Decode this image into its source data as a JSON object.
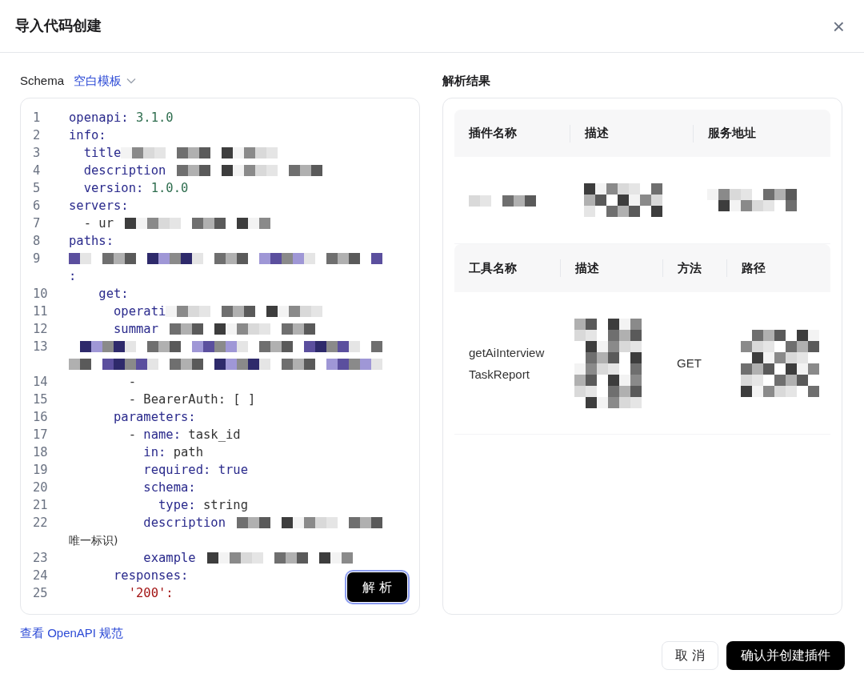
{
  "dialog": {
    "title": "导入代码创建",
    "close": "×"
  },
  "schema": {
    "label": "Schema",
    "template": "空白模板"
  },
  "editor": {
    "lines": [
      {
        "n": "1",
        "parts": [
          {
            "kind": "code",
            "text": "openapi: 3.1.0"
          }
        ]
      },
      {
        "n": "2",
        "parts": [
          {
            "kind": "code",
            "text": "info:"
          }
        ]
      },
      {
        "n": "3",
        "parts": [
          {
            "kind": "code",
            "text": "  title"
          },
          {
            "kind": "redacted"
          }
        ]
      },
      {
        "n": "4",
        "parts": [
          {
            "kind": "code",
            "text": "  description"
          },
          {
            "kind": "redacted"
          }
        ]
      },
      {
        "n": "5",
        "parts": [
          {
            "kind": "code",
            "text": "  version: 1.0.0"
          }
        ]
      },
      {
        "n": "6",
        "parts": [
          {
            "kind": "code",
            "text": "servers:"
          }
        ]
      },
      {
        "n": "7",
        "parts": [
          {
            "kind": "code",
            "text": "  - ur"
          },
          {
            "kind": "redacted"
          }
        ]
      },
      {
        "n": "8",
        "parts": [
          {
            "kind": "code",
            "text": "paths:"
          }
        ]
      },
      {
        "n": "9",
        "parts": [
          {
            "kind": "break"
          },
          {
            "kind": "redacted"
          },
          {
            "kind": "break"
          },
          {
            "kind": "code",
            "text": ":"
          }
        ]
      },
      {
        "n": "10",
        "parts": [
          {
            "kind": "code",
            "text": "    get:"
          }
        ]
      },
      {
        "n": "11",
        "parts": [
          {
            "kind": "code",
            "text": "      operati"
          },
          {
            "kind": "redacted"
          }
        ]
      },
      {
        "n": "12",
        "parts": [
          {
            "kind": "code",
            "text": "      summar"
          },
          {
            "kind": "redacted"
          }
        ]
      },
      {
        "n": "13",
        "parts": [
          {
            "kind": "redacted"
          },
          {
            "kind": "break"
          },
          {
            "kind": "redacted"
          }
        ]
      },
      {
        "n": "14",
        "parts": [
          {
            "kind": "code",
            "text": "        -"
          }
        ]
      },
      {
        "n": "15",
        "parts": [
          {
            "kind": "code",
            "text": "        - BearerAuth: [ ]"
          }
        ]
      },
      {
        "n": "16",
        "parts": [
          {
            "kind": "code",
            "text": "      parameters:"
          }
        ]
      },
      {
        "n": "17",
        "parts": [
          {
            "kind": "code",
            "text": "        - name: task_id"
          }
        ]
      },
      {
        "n": "18",
        "parts": [
          {
            "kind": "code",
            "text": "          in: path"
          }
        ]
      },
      {
        "n": "19",
        "parts": [
          {
            "kind": "code",
            "text": "          required: true"
          }
        ]
      },
      {
        "n": "20",
        "parts": [
          {
            "kind": "code",
            "text": "          schema:"
          }
        ]
      },
      {
        "n": "21",
        "parts": [
          {
            "kind": "code",
            "text": "            type: string"
          }
        ]
      },
      {
        "n": "22",
        "parts": [
          {
            "kind": "code",
            "text": "          description"
          },
          {
            "kind": "redacted"
          },
          {
            "kind": "break"
          },
          {
            "kind": "code",
            "text": "唯一标识)"
          }
        ]
      },
      {
        "n": "23",
        "parts": [
          {
            "kind": "code",
            "text": "          example"
          },
          {
            "kind": "redacted"
          }
        ]
      },
      {
        "n": "24",
        "parts": [
          {
            "kind": "code",
            "text": "      responses:"
          }
        ]
      },
      {
        "n": "25",
        "parts": [
          {
            "kind": "code",
            "text": "        '200':"
          }
        ]
      }
    ],
    "parse_button": "解 析"
  },
  "spec_link": "查看 OpenAPI 规范",
  "result": {
    "title": "解析结果",
    "plugin_table": {
      "columns": [
        "插件名称",
        "描述",
        "服务地址"
      ],
      "rows": [
        {
          "cells": [
            {
              "redacted": true
            },
            {
              "redacted": true
            },
            {
              "redacted": true
            }
          ]
        }
      ]
    },
    "tool_table": {
      "columns": [
        "工具名称",
        "描述",
        "方法",
        "路径"
      ],
      "rows": [
        {
          "cells": [
            {
              "redacted": false,
              "text": "getAiInterviewTaskReport"
            },
            {
              "redacted": true
            },
            {
              "redacted": false,
              "text": "GET"
            },
            {
              "redacted": true
            }
          ]
        }
      ]
    }
  },
  "buttons": [
    {
      "label": "取 消",
      "kind": "secondary"
    },
    {
      "label": "确认并创建插件",
      "kind": "primary"
    }
  ]
}
